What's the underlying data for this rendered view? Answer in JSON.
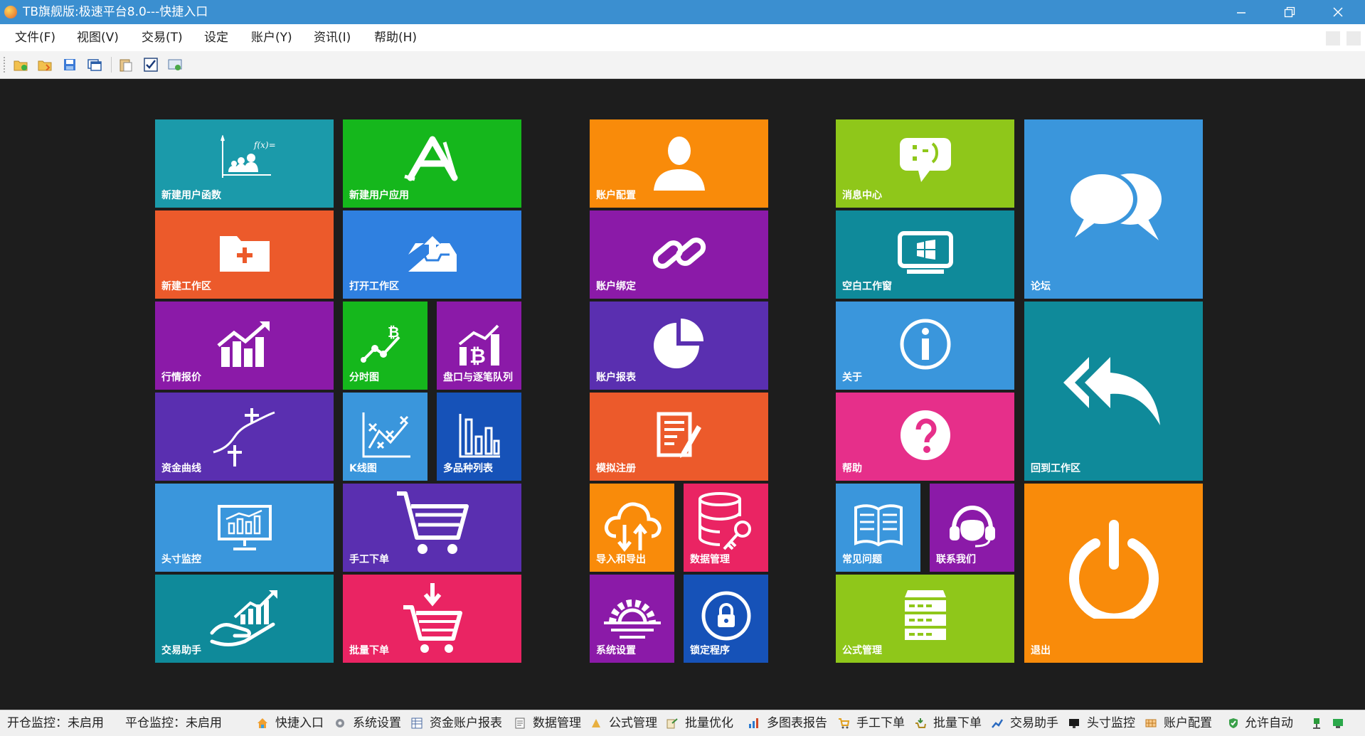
{
  "window": {
    "title": "TB旗舰版:极速平台8.0---快捷入口"
  },
  "menu": [
    {
      "label": "文件(F)"
    },
    {
      "label": "视图(V)"
    },
    {
      "label": "交易(T)"
    },
    {
      "label": "设定"
    },
    {
      "label": "账户(Y)"
    },
    {
      "label": "资讯(I)"
    },
    {
      "label": "帮助(H)"
    }
  ],
  "toolbar": {
    "icons": [
      "new-icon",
      "open-icon",
      "save-icon",
      "windows-icon",
      "paste-icon",
      "checkbox-icon",
      "settings-icon"
    ]
  },
  "colors": {
    "cyan": "#1b9aaa",
    "teal": "#0f8a9a",
    "green": "#15b71c",
    "lime": "#8fc71a",
    "orange": "#f98b0a",
    "red_orange": "#ec5a2b",
    "purple": "#8b1aa8",
    "indigo": "#5a2fb0",
    "blue": "#2f80e0",
    "sky": "#3a96dc",
    "navy": "#1652b8",
    "pink": "#e62f8a",
    "crimson": "#ea2463"
  },
  "tiles": {
    "new_user_func": "新建用户函数",
    "new_user_app": "新建用户应用",
    "account_config": "账户配置",
    "message_center": "消息中心",
    "forum": "论坛",
    "new_workspace": "新建工作区",
    "open_workspace": "打开工作区",
    "account_bind": "账户绑定",
    "blank_window": "空白工作窗",
    "quote": "行情报价",
    "time_chart": "分时图",
    "orderbook": "盘口与逐笔队列",
    "account_report": "账户报表",
    "about": "关于",
    "return_workspace": "回到工作区",
    "fund_curve": "资金曲线",
    "kline": "K线图",
    "multi_list": "多品种列表",
    "sim_register": "模拟注册",
    "help": "帮助",
    "position_monitor": "头寸监控",
    "manual_order": "手工下单",
    "import_export": "导入和导出",
    "data_mgmt": "数据管理",
    "faq": "常见问题",
    "contact": "联系我们",
    "exit": "退出",
    "trade_assist": "交易助手",
    "batch_order": "批量下单",
    "sys_settings": "系统设置",
    "lock": "锁定程序",
    "formula_mgmt": "公式管理"
  },
  "status": {
    "open_monitor": "开仓监控：未启用",
    "close_monitor": "平仓监控：未启用",
    "links": [
      "快捷入口",
      "系统设置",
      "资金账户报表",
      "数据管理",
      "公式管理",
      "批量优化",
      "多图表报告",
      "手工下单",
      "批量下单",
      "交易助手",
      "头寸监控",
      "账户配置",
      "允许自动"
    ]
  }
}
